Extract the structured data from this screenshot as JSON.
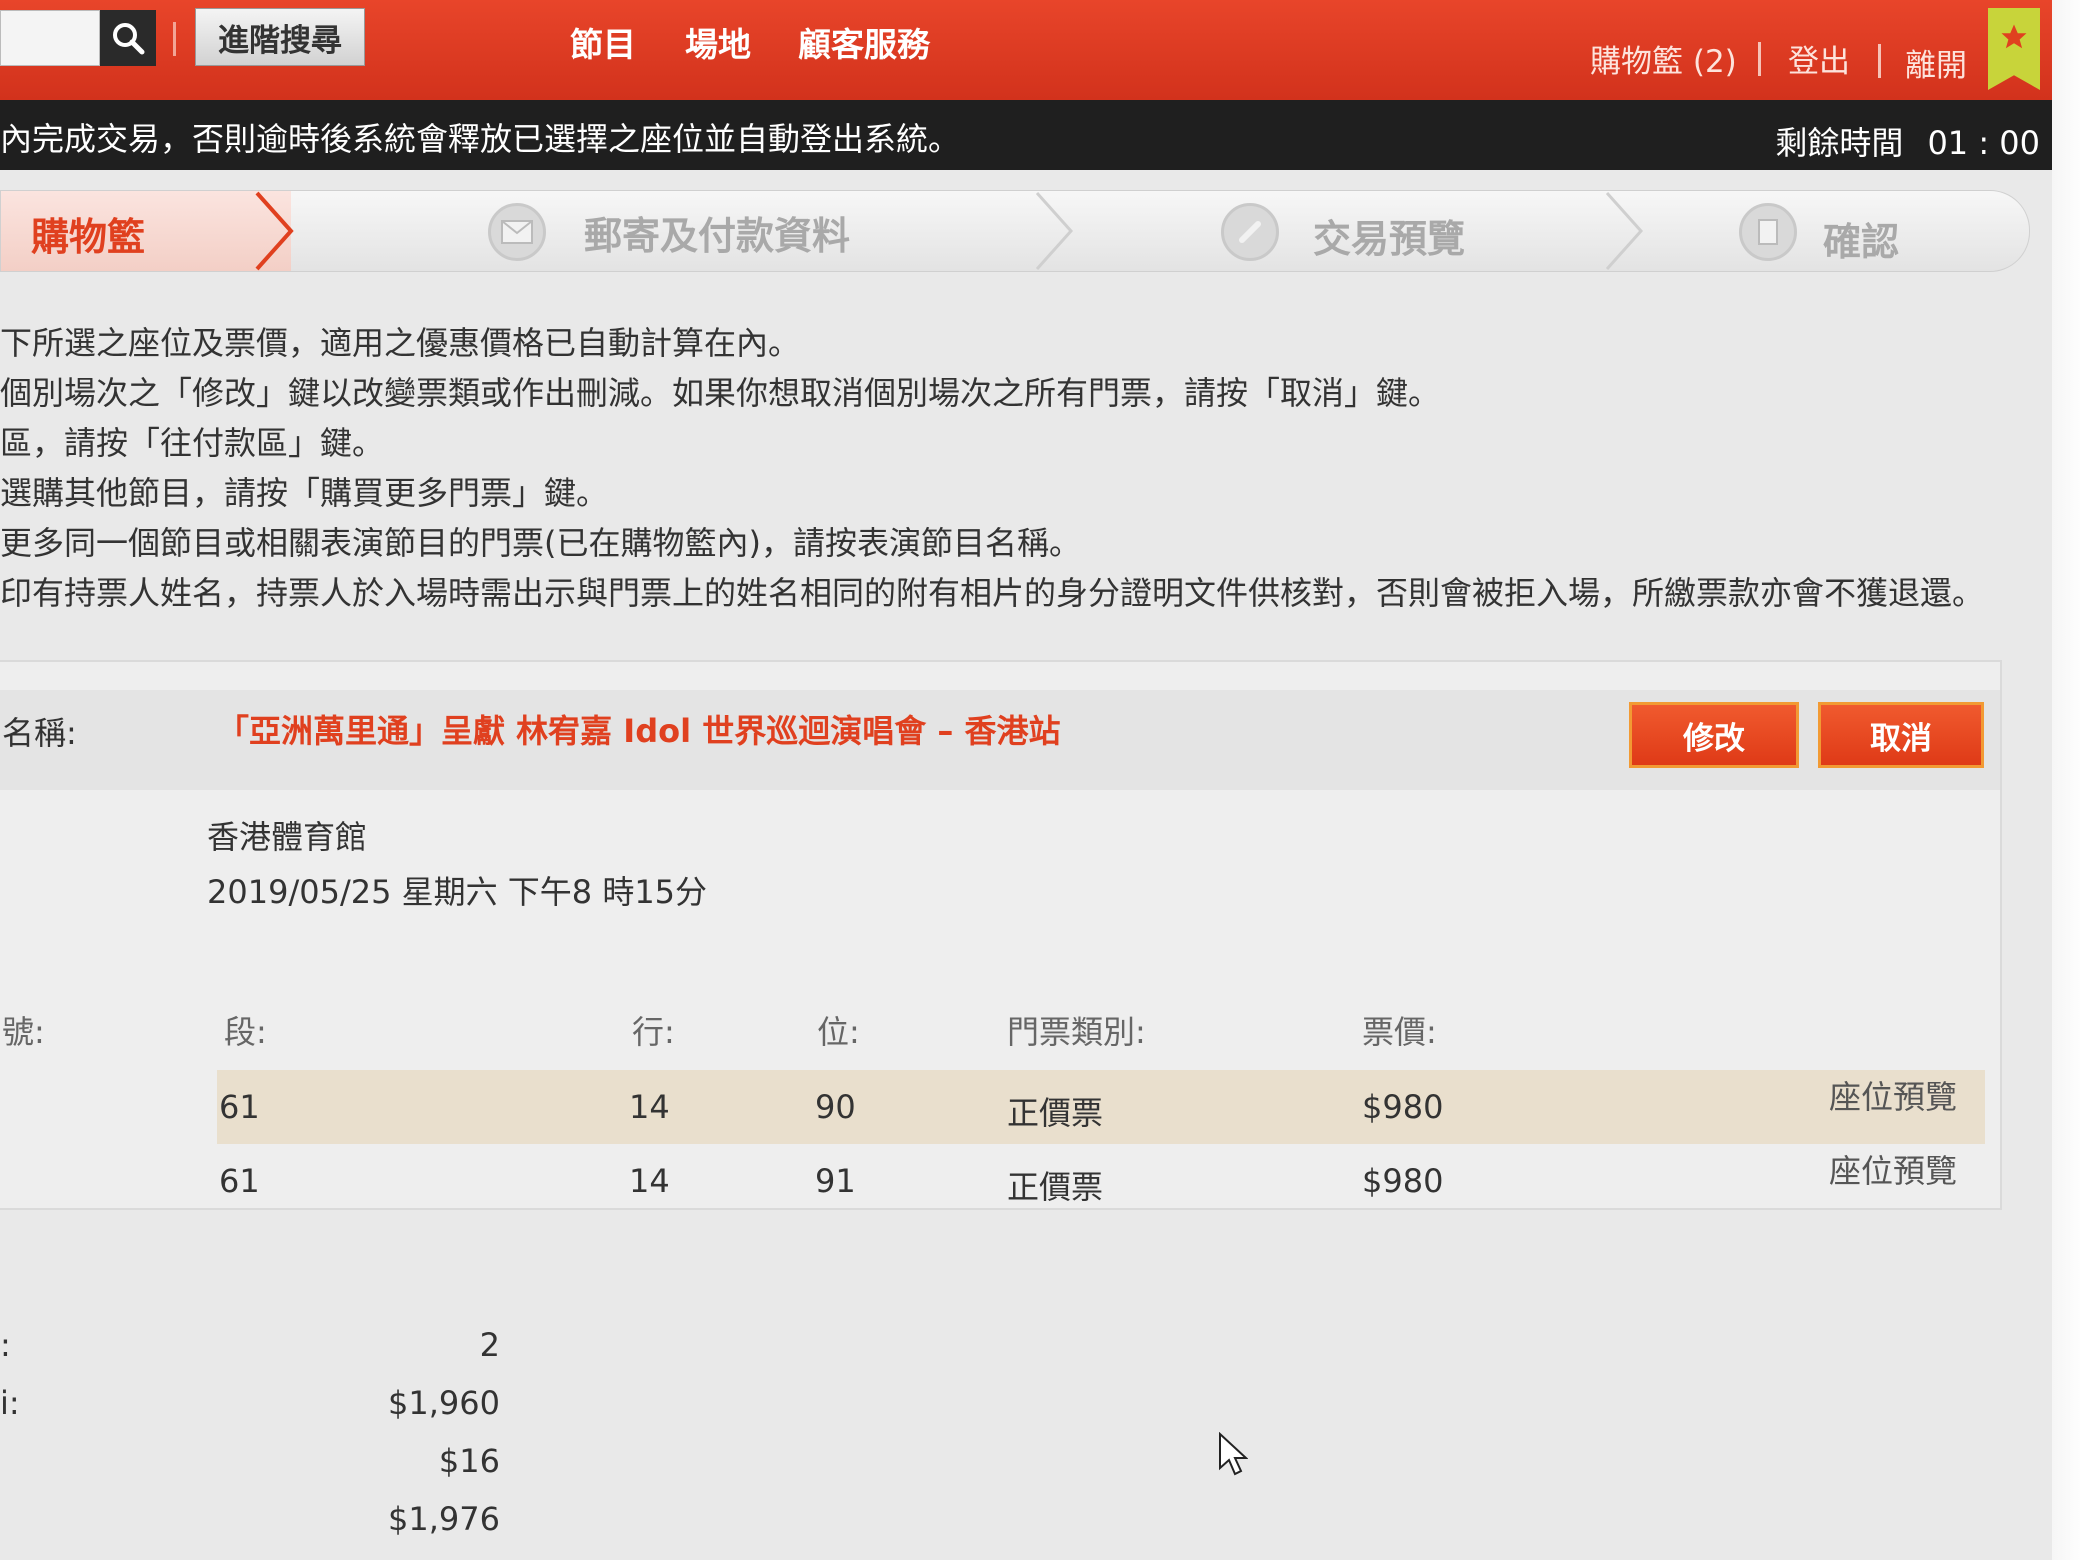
{
  "header": {
    "search_placeholder": "",
    "advanced_search_label": "進階搜尋",
    "nav": [
      "節目",
      "場地",
      "顧客服務"
    ],
    "cart_label": "購物籃 (2)",
    "logout_label": "登出",
    "exit_label": "離開",
    "brand_color": "#d9371f"
  },
  "warning": {
    "text": "內完成交易，否則逾時後系統會釋放已選擇之座位並自動登出系統。",
    "timer_label": "剩餘時間",
    "timer_value": "01 : 00"
  },
  "steps": [
    {
      "label": "購物籃",
      "active": true,
      "icon": "cart"
    },
    {
      "label": "郵寄及付款資料",
      "active": false,
      "icon": "mail-icon"
    },
    {
      "label": "交易預覽",
      "active": false,
      "icon": "pencil-icon"
    },
    {
      "label": "確認",
      "active": false,
      "icon": "document-icon"
    }
  ],
  "instructions": [
    "下所選之座位及票價，適用之優惠價格已自動計算在內。",
    "個別場次之「修改」鍵以改變票類或作出刪減。如果你想取消個別場次之所有門票，請按「取消」鍵。",
    "區，請按「往付款區」鍵。",
    "選購其他節目，請按「購買更多門票」鍵。",
    "更多同一個節目或相關表演節目的門票(已在購物籃內)，請按表演節目名稱。",
    "印有持票人姓名，持票人於入場時需出示與門票上的姓名相同的附有相片的身分證明文件供核對，否則會被拒入場，所繳票款亦會不獲退還。"
  ],
  "event": {
    "name_label": "名稱:",
    "title": "「亞洲萬里通」呈獻 林宥嘉 Idol 世界巡迴演唱會 – 香港站",
    "edit_label": "修改",
    "cancel_label": "取消",
    "venue": "香港體育館",
    "datetime": "2019/05/25 星期六 下午8 時15分",
    "columns": {
      "seat_label": "號:",
      "section": "段:",
      "row": "行:",
      "seat": "位:",
      "ticket_type": "門票類別:",
      "price": "票價:"
    },
    "seats": [
      {
        "section": "61",
        "row": "14",
        "seat": "90",
        "type": "正價票",
        "price": "$980",
        "preview": "座位預覽"
      },
      {
        "section": "61",
        "row": "14",
        "seat": "91",
        "type": "正價票",
        "price": "$980",
        "preview": "座位預覽"
      }
    ]
  },
  "totals": [
    {
      "label": ":",
      "value": "2"
    },
    {
      "label": "i:",
      "value": "$1,960"
    },
    {
      "label": "",
      "value": "$16"
    },
    {
      "label": "",
      "value": "$1,976"
    }
  ]
}
